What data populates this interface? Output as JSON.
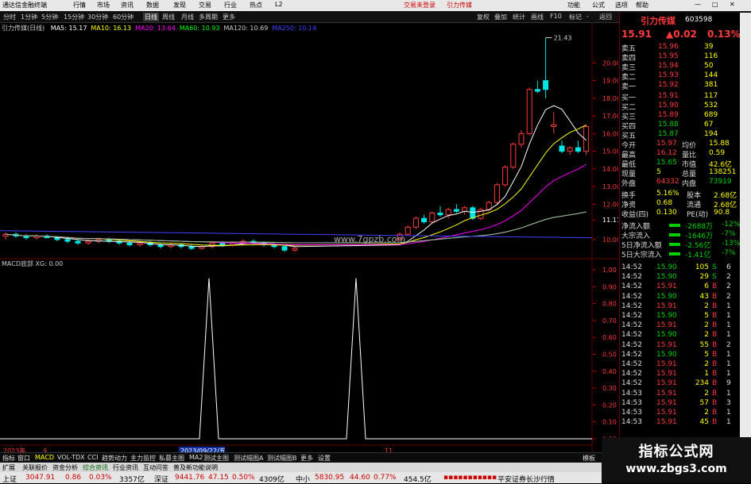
{
  "app": {
    "title": "通达信金融终端",
    "menu": [
      "行情",
      "市场",
      "资讯",
      "数据",
      "发现",
      "交易",
      "行业",
      "热点",
      "L2"
    ],
    "right_menu": [
      "功能",
      "公式",
      "选项",
      "帮助"
    ],
    "center_links": [
      "交易未登录",
      "引力传媒"
    ]
  },
  "periods": [
    "分时",
    "1分钟",
    "5分钟",
    "15分钟",
    "30分钟",
    "60分钟",
    "日线",
    "周线",
    "月线",
    "多周期",
    "更多"
  ],
  "selected_period": "日线",
  "toolbar_right": [
    "复权",
    "叠加",
    "统计",
    "画线",
    "F10",
    "标记",
    "-",
    "返回"
  ],
  "chart": {
    "stock_label": "引力传媒(日线)",
    "ma": [
      {
        "label": "MA5: 15.17",
        "color": "#ffffff"
      },
      {
        "label": "MA10: 16.13",
        "color": "#ffff00"
      },
      {
        "label": "MA20: 13.64",
        "color": "#ff00ff"
      },
      {
        "label": "MA60: 10.93",
        "color": "#00ff00"
      },
      {
        "label": "MA120: 10.69",
        "color": "#cccccc"
      },
      {
        "label": "MA250: 10.14",
        "color": "#4040ff"
      }
    ],
    "high_label": "21.43",
    "price_axis": [
      "20.00",
      "19.00",
      "18.00",
      "17.00",
      "16.00",
      "15.00",
      "14.00",
      "13.00",
      "12.00",
      "11.11",
      "10.00"
    ],
    "macd_label": "MACD底部 XG: 0.00",
    "macd_axis": [
      "1.00",
      "0.90",
      "0.80",
      "0.70",
      "0.60",
      "0.50",
      "0.40",
      "0.30",
      "0.20",
      "0.10",
      "0.00"
    ],
    "watermark": "www.7gpzb.com",
    "date_axis": {
      "year": "2023年",
      "month": "9",
      "date": "2023/09/22/五",
      "month2": "11"
    }
  },
  "chart_data": {
    "type": "candlestick",
    "ohlc": [
      [
        10.2,
        10.4,
        10.0,
        10.3
      ],
      [
        10.3,
        10.4,
        10.1,
        10.2
      ],
      [
        10.2,
        10.3,
        10.0,
        10.1
      ],
      [
        10.1,
        10.3,
        10.0,
        10.2
      ],
      [
        10.2,
        10.3,
        10.1,
        10.1
      ],
      [
        10.1,
        10.2,
        9.9,
        10.0
      ],
      [
        10.0,
        10.1,
        9.8,
        9.9
      ],
      [
        9.9,
        10.0,
        9.7,
        9.8
      ],
      [
        9.8,
        10.0,
        9.7,
        9.9
      ],
      [
        9.9,
        10.1,
        9.8,
        10.0
      ],
      [
        10.0,
        10.1,
        9.8,
        9.9
      ],
      [
        9.9,
        10.0,
        9.7,
        9.8
      ],
      [
        9.8,
        9.9,
        9.6,
        9.7
      ],
      [
        9.7,
        9.9,
        9.6,
        9.8
      ],
      [
        9.8,
        9.9,
        9.6,
        9.7
      ],
      [
        9.7,
        9.8,
        9.5,
        9.6
      ],
      [
        9.6,
        9.8,
        9.5,
        9.7
      ],
      [
        9.7,
        9.8,
        9.5,
        9.6
      ],
      [
        9.6,
        9.7,
        9.4,
        9.5
      ],
      [
        9.5,
        9.7,
        9.4,
        9.6
      ],
      [
        9.6,
        9.9,
        9.5,
        9.8
      ],
      [
        9.8,
        9.9,
        9.6,
        9.7
      ],
      [
        9.7,
        9.9,
        9.6,
        9.8
      ],
      [
        9.8,
        10.0,
        9.7,
        9.9
      ],
      [
        9.9,
        10.0,
        9.7,
        9.8
      ],
      [
        9.8,
        9.9,
        9.6,
        9.7
      ],
      [
        9.7,
        9.8,
        9.5,
        9.6
      ],
      [
        9.6,
        9.7,
        9.3,
        9.4
      ],
      [
        9.4,
        9.6,
        9.3,
        9.5
      ],
      [
        10.0,
        10.4,
        9.9,
        10.3
      ],
      [
        10.3,
        10.8,
        10.2,
        10.7
      ],
      [
        10.7,
        11.3,
        10.6,
        11.2
      ],
      [
        11.2,
        11.4,
        10.9,
        11.0
      ],
      [
        11.0,
        11.6,
        10.9,
        11.5
      ],
      [
        11.5,
        11.9,
        11.3,
        11.4
      ],
      [
        11.4,
        11.8,
        11.2,
        11.7
      ],
      [
        11.7,
        12.0,
        11.5,
        11.6
      ],
      [
        11.6,
        11.9,
        11.4,
        11.8
      ],
      [
        11.8,
        11.9,
        11.1,
        11.2
      ],
      [
        11.2,
        11.8,
        11.1,
        11.7
      ],
      [
        11.7,
        12.2,
        11.6,
        12.1
      ],
      [
        12.1,
        13.2,
        12.0,
        13.1
      ],
      [
        13.1,
        14.2,
        13.0,
        14.1
      ],
      [
        14.1,
        15.5,
        14.0,
        15.4
      ],
      [
        15.4,
        16.2,
        15.2,
        16.0
      ],
      [
        16.0,
        18.6,
        15.9,
        18.5
      ],
      [
        18.5,
        19.0,
        18.3,
        18.4
      ],
      [
        19.0,
        21.43,
        18.0,
        18.5
      ],
      [
        16.4,
        17.2,
        16.0,
        16.5
      ],
      [
        15.3,
        15.6,
        14.9,
        15.0
      ],
      [
        15.0,
        15.3,
        14.8,
        15.2
      ],
      [
        15.2,
        15.6,
        14.9,
        15.0
      ],
      [
        15.0,
        16.5,
        14.8,
        16.4
      ]
    ],
    "macd_signal_peaks": [
      0.95,
      0.95
    ],
    "ylim": [
      9.5,
      21.5
    ]
  },
  "quote": {
    "name": "引力传媒",
    "code": "603598",
    "price": "15.91",
    "change": "▲0.02",
    "change_pct": "0.13%",
    "asks": [
      {
        "label": "卖五",
        "price": "15.96",
        "vol": "39"
      },
      {
        "label": "卖四",
        "price": "15.95",
        "vol": "116"
      },
      {
        "label": "卖三",
        "price": "15.94",
        "vol": "50"
      },
      {
        "label": "卖二",
        "price": "15.93",
        "vol": "144"
      },
      {
        "label": "卖一",
        "price": "15.92",
        "vol": "381"
      }
    ],
    "bids": [
      {
        "label": "买一",
        "price": "15.91",
        "vol": "117"
      },
      {
        "label": "买二",
        "price": "15.90",
        "vol": "532"
      },
      {
        "label": "买三",
        "price": "15.89",
        "vol": "689"
      },
      {
        "label": "买四",
        "price": "15.88",
        "vol": "67"
      },
      {
        "label": "买五",
        "price": "15.87",
        "vol": "194"
      }
    ],
    "stats": [
      {
        "l1": "今开",
        "v1": "15.97",
        "l2": "均价",
        "v2": "15.88"
      },
      {
        "l1": "最高",
        "v1": "16.12",
        "l2": "量比",
        "v2": "0.59"
      },
      {
        "l1": "最低",
        "v1": "15.65",
        "l2": "市值",
        "v2": "42.6亿"
      },
      {
        "l1": "现量",
        "v1": "5",
        "l2": "总量",
        "v2": "138251"
      },
      {
        "l1": "外盘",
        "v1": "64332",
        "l2": "内盘",
        "v2": "73919"
      }
    ],
    "stats2": [
      {
        "l1": "换手",
        "v1": "5.16%",
        "l2": "股本",
        "v2": "2.68亿"
      },
      {
        "l1": "净资",
        "v1": "0.68",
        "l2": "流通",
        "v2": "2.68亿"
      },
      {
        "l1": "收益(四)",
        "v1": "0.130",
        "l2": "PE(动)",
        "v2": "90.8"
      }
    ],
    "flows": [
      {
        "label": "净流入额",
        "value": "-2688万",
        "pct": "-12%"
      },
      {
        "label": "大宗流入",
        "value": "-1646万",
        "pct": "-7%"
      },
      {
        "label": "5日净流入额",
        "value": "-2.56亿",
        "pct": "-13%"
      },
      {
        "label": "5日大宗流入",
        "value": "-1.41亿",
        "pct": "-7%"
      }
    ],
    "ticks": [
      {
        "t": "14:52",
        "p": "15.90",
        "v": "105",
        "d": "S",
        "n": "6"
      },
      {
        "t": "14:52",
        "p": "15.90",
        "v": "29",
        "d": "S",
        "n": "2"
      },
      {
        "t": "14:52",
        "p": "15.91",
        "v": "6",
        "d": "B",
        "n": "2"
      },
      {
        "t": "14:52",
        "p": "15.90",
        "v": "43",
        "d": "B",
        "n": "2"
      },
      {
        "t": "14:52",
        "p": "15.91",
        "v": "2",
        "d": "B",
        "n": "1"
      },
      {
        "t": "14:52",
        "p": "15.90",
        "v": "5",
        "d": "B",
        "n": "1"
      },
      {
        "t": "14:52",
        "p": "15.91",
        "v": "2",
        "d": "B",
        "n": "1"
      },
      {
        "t": "14:52",
        "p": "15.90",
        "v": "2",
        "d": "B",
        "n": "1"
      },
      {
        "t": "14:52",
        "p": "15.91",
        "v": "55",
        "d": "B",
        "n": "2"
      },
      {
        "t": "14:52",
        "p": "15.90",
        "v": "5",
        "d": "B",
        "n": "1"
      },
      {
        "t": "14:52",
        "p": "15.91",
        "v": "2",
        "d": "B",
        "n": "1"
      },
      {
        "t": "14:52",
        "p": "15.91",
        "v": "1",
        "d": "B",
        "n": "1"
      },
      {
        "t": "14:52",
        "p": "15.91",
        "v": "234",
        "d": "B",
        "n": "9"
      },
      {
        "t": "14:53",
        "p": "15.91",
        "v": "2",
        "d": "B",
        "n": "1"
      },
      {
        "t": "14:53",
        "p": "15.91",
        "v": "57",
        "d": "B",
        "n": "3"
      },
      {
        "t": "14:53",
        "p": "15.91",
        "v": "2",
        "d": "B",
        "n": "1"
      },
      {
        "t": "14:53",
        "p": "15.91",
        "v": "45",
        "d": "B",
        "n": "1"
      }
    ]
  },
  "bottom_tabs": [
    "指标",
    "窗口",
    "MACD",
    "VOL-TDX",
    "CCI",
    "趋势动力",
    "主力监控",
    "私募主图",
    "MA2",
    "测试主图",
    "测试幅图A",
    "测试幅图B",
    "更多",
    "设置"
  ],
  "bottom_right": "模板",
  "status_tabs": [
    "扩展",
    "关联报价",
    "资金分析",
    "综合资讯",
    "行业资讯",
    "互动问答",
    "普及新功能说明"
  ],
  "indexes": [
    {
      "name": "上证",
      "val": "3047.91",
      "chg": "0.86",
      "pct": "0.03%",
      "amt": "3357亿"
    },
    {
      "name": "深证",
      "val": "9441.76",
      "chg": "47.15",
      "pct": "0.50%",
      "amt": "4309亿"
    },
    {
      "name": "中小",
      "val": "5830.95",
      "chg": "44.60",
      "pct": "0.77%",
      "amt": "454.5亿"
    }
  ],
  "status_right": "平安证券长沙行情",
  "site_watermark": {
    "line1": "指标公式网",
    "line2": "www.zbgs3.com"
  }
}
